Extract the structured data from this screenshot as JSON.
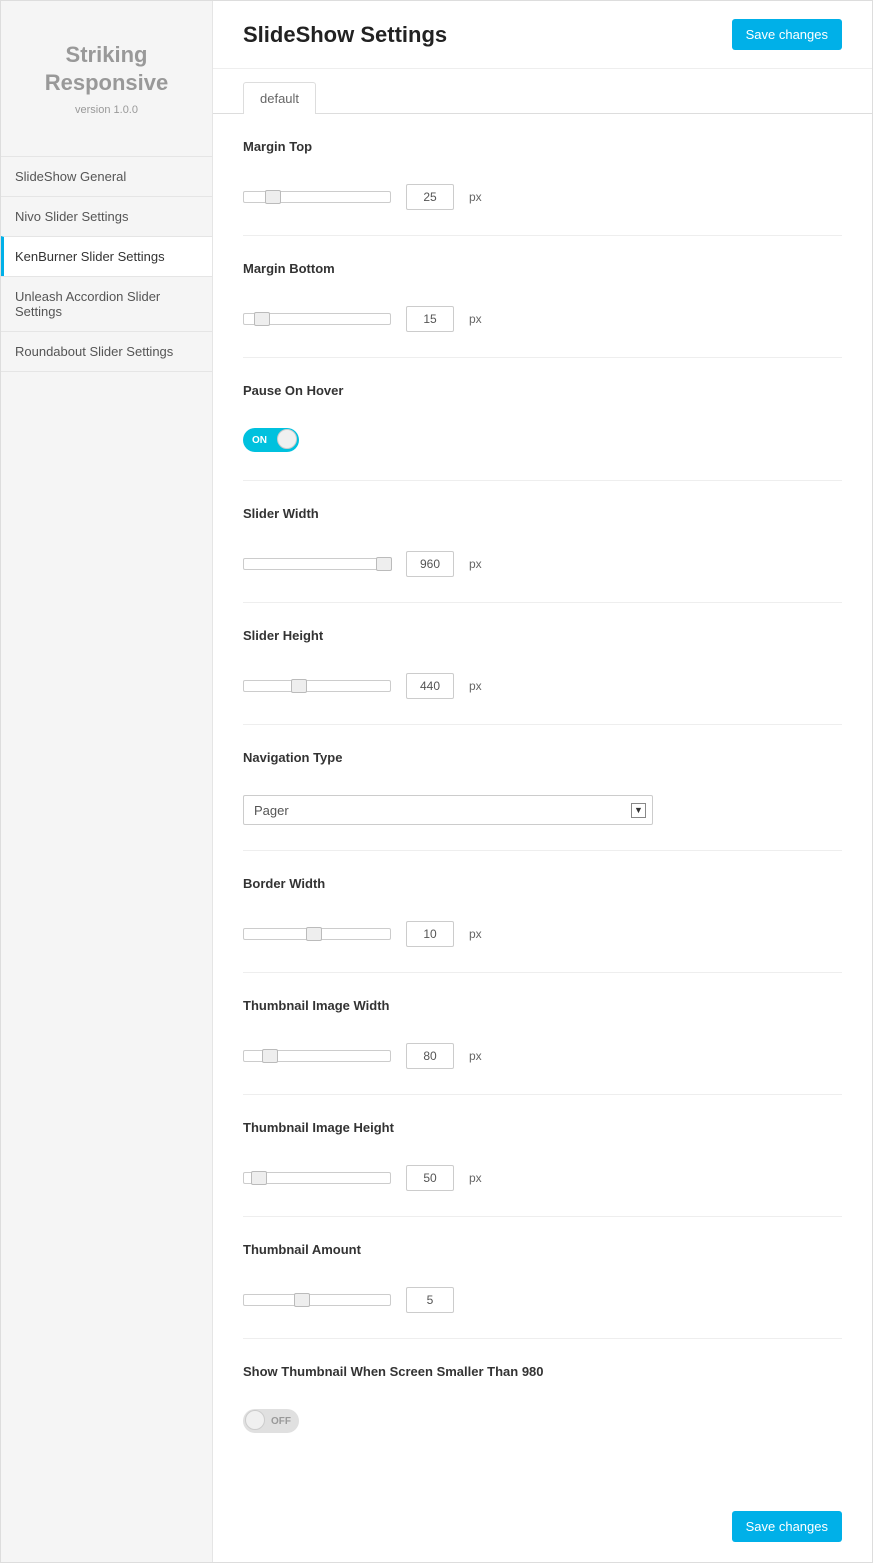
{
  "sidebar": {
    "title_line1": "Striking",
    "title_line2": "Responsive",
    "version": "version 1.0.0",
    "items": [
      {
        "label": "SlideShow General"
      },
      {
        "label": "Nivo Slider Settings"
      },
      {
        "label": "KenBurner Slider Settings"
      },
      {
        "label": "Unleash Accordion Slider Settings"
      },
      {
        "label": "Roundabout Slider Settings"
      }
    ],
    "active_index": 2
  },
  "header": {
    "title": "SlideShow Settings",
    "save_label": "Save changes"
  },
  "tabs": [
    {
      "label": "default"
    }
  ],
  "toggle_labels": {
    "on": "ON",
    "off": "OFF"
  },
  "fields": {
    "margin_top": {
      "label": "Margin Top",
      "value": "25",
      "unit": "px",
      "percent": 20
    },
    "margin_bottom": {
      "label": "Margin Bottom",
      "value": "15",
      "unit": "px",
      "percent": 12
    },
    "pause_on_hover": {
      "label": "Pause On Hover",
      "value": true
    },
    "slider_width": {
      "label": "Slider Width",
      "value": "960",
      "unit": "px",
      "percent": 96
    },
    "slider_height": {
      "label": "Slider Height",
      "value": "440",
      "unit": "px",
      "percent": 38
    },
    "navigation_type": {
      "label": "Navigation Type",
      "value": "Pager"
    },
    "border_width": {
      "label": "Border Width",
      "value": "10",
      "unit": "px",
      "percent": 48
    },
    "thumb_width": {
      "label": "Thumbnail Image Width",
      "value": "80",
      "unit": "px",
      "percent": 18
    },
    "thumb_height": {
      "label": "Thumbnail Image Height",
      "value": "50",
      "unit": "px",
      "percent": 10
    },
    "thumb_amount": {
      "label": "Thumbnail Amount",
      "value": "5",
      "percent": 40
    },
    "show_thumb_small": {
      "label": "Show Thumbnail When Screen Smaller Than 980",
      "value": false
    }
  },
  "footer": {
    "save_label": "Save changes"
  }
}
